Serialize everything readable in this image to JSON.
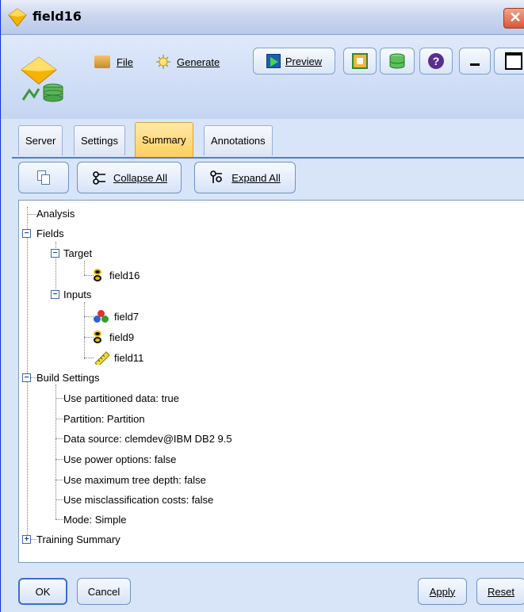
{
  "window": {
    "title": "field16",
    "close_glyph": "✕"
  },
  "toolbar": {
    "file_label": "File",
    "generate_label": "Generate",
    "preview_label": "Preview"
  },
  "tabs": [
    {
      "label": "Server"
    },
    {
      "label": "Settings"
    },
    {
      "label": "Summary",
      "active": true
    },
    {
      "label": "Annotations"
    }
  ],
  "summary_toolbar": {
    "collapse_label": "Collapse All",
    "expand_label": "Expand All"
  },
  "tree": {
    "analysis": "Analysis",
    "fields": "Fields",
    "target": "Target",
    "target_field": "field16",
    "inputs": "Inputs",
    "input_fields": [
      "field7",
      "field9",
      "field11"
    ],
    "build_settings": "Build Settings",
    "settings": [
      "Use partitioned data: true",
      "Partition: Partition",
      "Data source: clemdev@IBM DB2 9.5",
      "Use power options: false",
      "Use maximum tree depth: false",
      "Use misclassification costs: false",
      "Mode: Simple"
    ],
    "training_summary": "Training Summary"
  },
  "footer": {
    "ok_label": "OK",
    "cancel_label": "Cancel",
    "apply_label": "Apply",
    "reset_label": "Reset"
  },
  "colors": {
    "window_bg": "#d8e4f8",
    "active_tab": "#ffcf5e",
    "panel_border": "#4a7fd6"
  }
}
